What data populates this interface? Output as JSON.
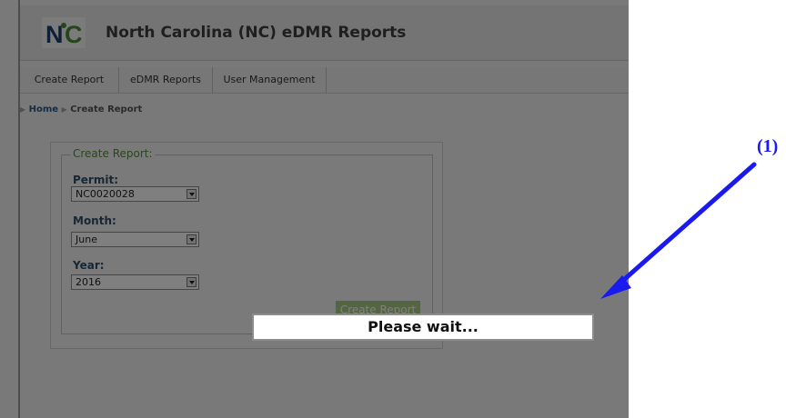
{
  "app": {
    "title": "North Carolina (NC) eDMR Reports",
    "logo_text": "NC"
  },
  "nav": {
    "items": [
      {
        "label": "Create Report"
      },
      {
        "label": "eDMR Reports"
      },
      {
        "label": "User Management"
      }
    ]
  },
  "breadcrumb": {
    "home": "Home",
    "current": "Create Report"
  },
  "form": {
    "legend": "Create Report:",
    "permit": {
      "label": "Permit:",
      "value": "NC0020028"
    },
    "month": {
      "label": "Month:",
      "value": "June"
    },
    "year": {
      "label": "Year:",
      "value": "2016"
    },
    "submit_label": "Create Report"
  },
  "modal": {
    "message": "Please wait..."
  },
  "annotation": {
    "label": "(1)",
    "color": "#1a1aee"
  },
  "colors": {
    "legend": "#5a8a3c",
    "button": "#a9cc82",
    "link": "#2f5a8a",
    "logo_blue": "#1f3f6a",
    "logo_green": "#4a8a3a"
  }
}
